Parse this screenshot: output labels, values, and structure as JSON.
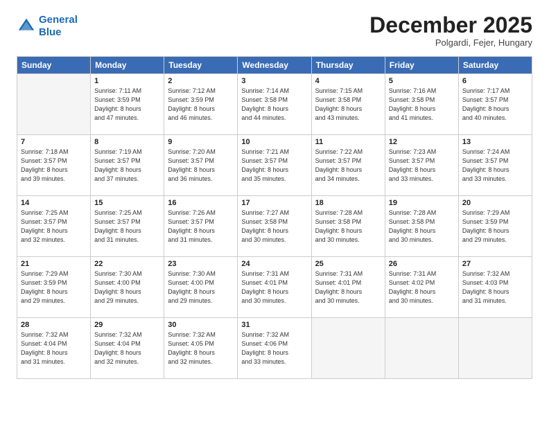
{
  "logo": {
    "line1": "General",
    "line2": "Blue"
  },
  "title": "December 2025",
  "location": "Polgardi, Fejer, Hungary",
  "weekdays": [
    "Sunday",
    "Monday",
    "Tuesday",
    "Wednesday",
    "Thursday",
    "Friday",
    "Saturday"
  ],
  "weeks": [
    [
      {
        "day": "",
        "info": ""
      },
      {
        "day": "1",
        "info": "Sunrise: 7:11 AM\nSunset: 3:59 PM\nDaylight: 8 hours\nand 47 minutes."
      },
      {
        "day": "2",
        "info": "Sunrise: 7:12 AM\nSunset: 3:59 PM\nDaylight: 8 hours\nand 46 minutes."
      },
      {
        "day": "3",
        "info": "Sunrise: 7:14 AM\nSunset: 3:58 PM\nDaylight: 8 hours\nand 44 minutes."
      },
      {
        "day": "4",
        "info": "Sunrise: 7:15 AM\nSunset: 3:58 PM\nDaylight: 8 hours\nand 43 minutes."
      },
      {
        "day": "5",
        "info": "Sunrise: 7:16 AM\nSunset: 3:58 PM\nDaylight: 8 hours\nand 41 minutes."
      },
      {
        "day": "6",
        "info": "Sunrise: 7:17 AM\nSunset: 3:57 PM\nDaylight: 8 hours\nand 40 minutes."
      }
    ],
    [
      {
        "day": "7",
        "info": "Sunrise: 7:18 AM\nSunset: 3:57 PM\nDaylight: 8 hours\nand 39 minutes."
      },
      {
        "day": "8",
        "info": "Sunrise: 7:19 AM\nSunset: 3:57 PM\nDaylight: 8 hours\nand 37 minutes."
      },
      {
        "day": "9",
        "info": "Sunrise: 7:20 AM\nSunset: 3:57 PM\nDaylight: 8 hours\nand 36 minutes."
      },
      {
        "day": "10",
        "info": "Sunrise: 7:21 AM\nSunset: 3:57 PM\nDaylight: 8 hours\nand 35 minutes."
      },
      {
        "day": "11",
        "info": "Sunrise: 7:22 AM\nSunset: 3:57 PM\nDaylight: 8 hours\nand 34 minutes."
      },
      {
        "day": "12",
        "info": "Sunrise: 7:23 AM\nSunset: 3:57 PM\nDaylight: 8 hours\nand 33 minutes."
      },
      {
        "day": "13",
        "info": "Sunrise: 7:24 AM\nSunset: 3:57 PM\nDaylight: 8 hours\nand 33 minutes."
      }
    ],
    [
      {
        "day": "14",
        "info": "Sunrise: 7:25 AM\nSunset: 3:57 PM\nDaylight: 8 hours\nand 32 minutes."
      },
      {
        "day": "15",
        "info": "Sunrise: 7:25 AM\nSunset: 3:57 PM\nDaylight: 8 hours\nand 31 minutes."
      },
      {
        "day": "16",
        "info": "Sunrise: 7:26 AM\nSunset: 3:57 PM\nDaylight: 8 hours\nand 31 minutes."
      },
      {
        "day": "17",
        "info": "Sunrise: 7:27 AM\nSunset: 3:58 PM\nDaylight: 8 hours\nand 30 minutes."
      },
      {
        "day": "18",
        "info": "Sunrise: 7:28 AM\nSunset: 3:58 PM\nDaylight: 8 hours\nand 30 minutes."
      },
      {
        "day": "19",
        "info": "Sunrise: 7:28 AM\nSunset: 3:58 PM\nDaylight: 8 hours\nand 30 minutes."
      },
      {
        "day": "20",
        "info": "Sunrise: 7:29 AM\nSunset: 3:59 PM\nDaylight: 8 hours\nand 29 minutes."
      }
    ],
    [
      {
        "day": "21",
        "info": "Sunrise: 7:29 AM\nSunset: 3:59 PM\nDaylight: 8 hours\nand 29 minutes."
      },
      {
        "day": "22",
        "info": "Sunrise: 7:30 AM\nSunset: 4:00 PM\nDaylight: 8 hours\nand 29 minutes."
      },
      {
        "day": "23",
        "info": "Sunrise: 7:30 AM\nSunset: 4:00 PM\nDaylight: 8 hours\nand 29 minutes."
      },
      {
        "day": "24",
        "info": "Sunrise: 7:31 AM\nSunset: 4:01 PM\nDaylight: 8 hours\nand 30 minutes."
      },
      {
        "day": "25",
        "info": "Sunrise: 7:31 AM\nSunset: 4:01 PM\nDaylight: 8 hours\nand 30 minutes."
      },
      {
        "day": "26",
        "info": "Sunrise: 7:31 AM\nSunset: 4:02 PM\nDaylight: 8 hours\nand 30 minutes."
      },
      {
        "day": "27",
        "info": "Sunrise: 7:32 AM\nSunset: 4:03 PM\nDaylight: 8 hours\nand 31 minutes."
      }
    ],
    [
      {
        "day": "28",
        "info": "Sunrise: 7:32 AM\nSunset: 4:04 PM\nDaylight: 8 hours\nand 31 minutes."
      },
      {
        "day": "29",
        "info": "Sunrise: 7:32 AM\nSunset: 4:04 PM\nDaylight: 8 hours\nand 32 minutes."
      },
      {
        "day": "30",
        "info": "Sunrise: 7:32 AM\nSunset: 4:05 PM\nDaylight: 8 hours\nand 32 minutes."
      },
      {
        "day": "31",
        "info": "Sunrise: 7:32 AM\nSunset: 4:06 PM\nDaylight: 8 hours\nand 33 minutes."
      },
      {
        "day": "",
        "info": ""
      },
      {
        "day": "",
        "info": ""
      },
      {
        "day": "",
        "info": ""
      }
    ]
  ]
}
